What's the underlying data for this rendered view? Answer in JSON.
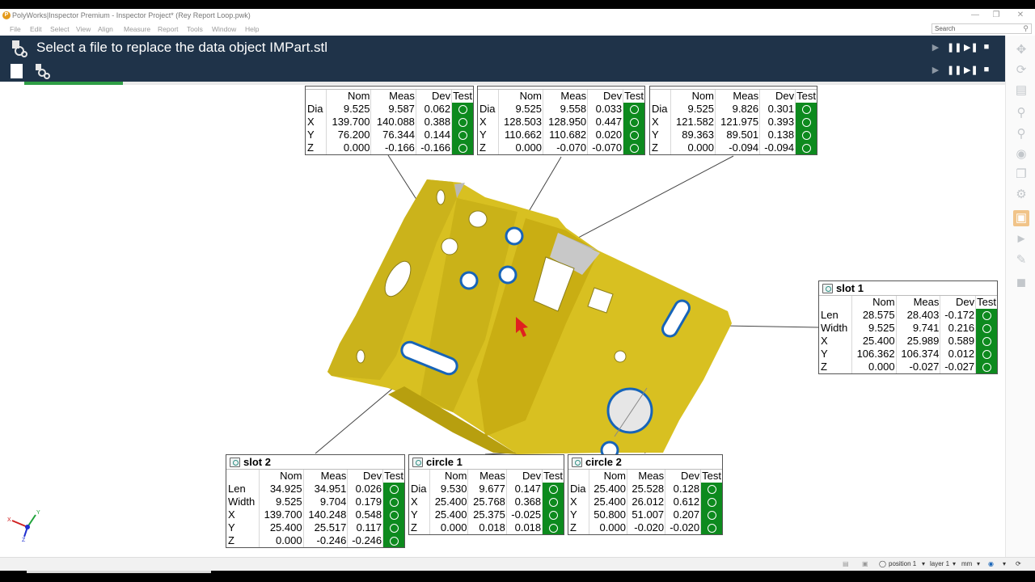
{
  "app": {
    "title": "PolyWorks|Inspector Premium - Inspector Project* (Rey Report Loop.pwk)",
    "menu": [
      "File",
      "Edit",
      "Select",
      "View",
      "Align",
      "Measure",
      "Report",
      "Tools",
      "Window",
      "Help"
    ],
    "search_placeholder": "Search"
  },
  "instruction": {
    "message": "Select a file to replace the data object IMPart.stl"
  },
  "colors": {
    "header_bg": "#1f3349",
    "pass_green": "#0d8a1e",
    "part_yellow": "#d8c021",
    "progress_green": "#2e9e45"
  },
  "icons": {
    "playback": [
      "play-icon",
      "pause-icon",
      "step-forward-icon",
      "stop-icon"
    ],
    "sidebar": [
      "pan-icon",
      "rotate-icon",
      "ruler-icon",
      "zoom-icon",
      "zoom-fit-icon",
      "eye-icon",
      "cube-icon",
      "settings-icon",
      "view-icon",
      "probe-icon",
      "measure-tool-icon",
      "node-icon"
    ]
  },
  "tables": {
    "hdr": {
      "nom": "Nom",
      "meas": "Meas",
      "dev": "Dev",
      "test": "Test"
    },
    "t1": {
      "rows": [
        {
          "lbl": "Dia",
          "nom": "9.525",
          "meas": "9.587",
          "dev": "0.062"
        },
        {
          "lbl": "X",
          "nom": "139.700",
          "meas": "140.088",
          "dev": "0.388"
        },
        {
          "lbl": "Y",
          "nom": "76.200",
          "meas": "76.344",
          "dev": "0.144"
        },
        {
          "lbl": "Z",
          "nom": "0.000",
          "meas": "-0.166",
          "dev": "-0.166"
        }
      ]
    },
    "t2": {
      "rows": [
        {
          "lbl": "Dia",
          "nom": "9.525",
          "meas": "9.558",
          "dev": "0.033"
        },
        {
          "lbl": "X",
          "nom": "128.503",
          "meas": "128.950",
          "dev": "0.447"
        },
        {
          "lbl": "Y",
          "nom": "110.662",
          "meas": "110.682",
          "dev": "0.020"
        },
        {
          "lbl": "Z",
          "nom": "0.000",
          "meas": "-0.070",
          "dev": "-0.070"
        }
      ]
    },
    "t3": {
      "rows": [
        {
          "lbl": "Dia",
          "nom": "9.525",
          "meas": "9.826",
          "dev": "0.301"
        },
        {
          "lbl": "X",
          "nom": "121.582",
          "meas": "121.975",
          "dev": "0.393"
        },
        {
          "lbl": "Y",
          "nom": "89.363",
          "meas": "89.501",
          "dev": "0.138"
        },
        {
          "lbl": "Z",
          "nom": "0.000",
          "meas": "-0.094",
          "dev": "-0.094"
        }
      ]
    },
    "slot1": {
      "title": "slot 1",
      "rows": [
        {
          "lbl": "Len",
          "nom": "28.575",
          "meas": "28.403",
          "dev": "-0.172"
        },
        {
          "lbl": "Width",
          "nom": "9.525",
          "meas": "9.741",
          "dev": "0.216"
        },
        {
          "lbl": "X",
          "nom": "25.400",
          "meas": "25.989",
          "dev": "0.589"
        },
        {
          "lbl": "Y",
          "nom": "106.362",
          "meas": "106.374",
          "dev": "0.012"
        },
        {
          "lbl": "Z",
          "nom": "0.000",
          "meas": "-0.027",
          "dev": "-0.027"
        }
      ]
    },
    "slot2": {
      "title": "slot 2",
      "rows": [
        {
          "lbl": "Len",
          "nom": "34.925",
          "meas": "34.951",
          "dev": "0.026"
        },
        {
          "lbl": "Width",
          "nom": "9.525",
          "meas": "9.704",
          "dev": "0.179"
        },
        {
          "lbl": "X",
          "nom": "139.700",
          "meas": "140.248",
          "dev": "0.548"
        },
        {
          "lbl": "Y",
          "nom": "25.400",
          "meas": "25.517",
          "dev": "0.117"
        },
        {
          "lbl": "Z",
          "nom": "0.000",
          "meas": "-0.246",
          "dev": "-0.246"
        }
      ]
    },
    "circle1": {
      "title": "circle 1",
      "rows": [
        {
          "lbl": "Dia",
          "nom": "9.530",
          "meas": "9.677",
          "dev": "0.147"
        },
        {
          "lbl": "X",
          "nom": "25.400",
          "meas": "25.768",
          "dev": "0.368"
        },
        {
          "lbl": "Y",
          "nom": "25.400",
          "meas": "25.375",
          "dev": "-0.025"
        },
        {
          "lbl": "Z",
          "nom": "0.000",
          "meas": "0.018",
          "dev": "0.018"
        }
      ]
    },
    "circle2": {
      "title": "circle 2",
      "rows": [
        {
          "lbl": "Dia",
          "nom": "25.400",
          "meas": "25.528",
          "dev": "0.128"
        },
        {
          "lbl": "X",
          "nom": "25.400",
          "meas": "26.012",
          "dev": "0.612"
        },
        {
          "lbl": "Y",
          "nom": "50.800",
          "meas": "51.007",
          "dev": "0.207"
        },
        {
          "lbl": "Z",
          "nom": "0.000",
          "meas": "-0.020",
          "dev": "-0.020"
        }
      ]
    }
  },
  "axes": {
    "x": "X",
    "y": "Y",
    "z": "Z"
  },
  "status": {
    "position": "position 1",
    "layer": "layer 1",
    "unit": "mm"
  }
}
